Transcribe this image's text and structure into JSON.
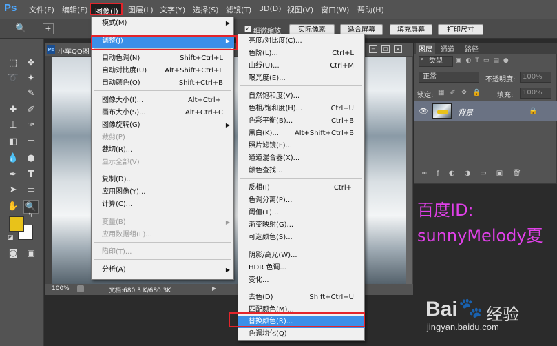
{
  "app": {
    "logo": "Ps"
  },
  "menubar": [
    {
      "label": "文件(F)"
    },
    {
      "label": "编辑(E)"
    },
    {
      "label": "图像(I)"
    },
    {
      "label": "图层(L)"
    },
    {
      "label": "文字(Y)"
    },
    {
      "label": "选择(S)"
    },
    {
      "label": "滤镜(T)"
    },
    {
      "label": "3D(D)"
    },
    {
      "label": "视图(V)"
    },
    {
      "label": "窗口(W)"
    },
    {
      "label": "帮助(H)"
    }
  ],
  "options": {
    "fine_zoom_label": "细微缩放",
    "buttons": [
      "实际像素",
      "适合屏幕",
      "填充屏幕",
      "打印尺寸"
    ]
  },
  "document": {
    "tab_title": "小车QQ图",
    "zoom": "100%",
    "status": "文档:680.3 K/680.3K"
  },
  "layers_panel": {
    "tabs": [
      "图层",
      "通道",
      "路径"
    ],
    "kind": "类型",
    "blend_mode": "正常",
    "opacity_label": "不透明度:",
    "opacity_value": "100%",
    "lock_label": "锁定:",
    "fill_label": "填充:",
    "fill_value": "100%",
    "layer_name": "背景"
  },
  "image_menu": [
    {
      "label": "模式(M)",
      "shortcut": "",
      "submenu": true,
      "disabled": false
    },
    {
      "label": "调整(J)",
      "shortcut": "",
      "submenu": true,
      "disabled": false,
      "highlighted": true
    },
    {
      "label": "自动色调(N)",
      "shortcut": "Shift+Ctrl+L",
      "submenu": false,
      "disabled": false
    },
    {
      "label": "自动对比度(U)",
      "shortcut": "Alt+Shift+Ctrl+L",
      "submenu": false,
      "disabled": false
    },
    {
      "label": "自动颜色(O)",
      "shortcut": "Shift+Ctrl+B",
      "submenu": false,
      "disabled": false
    },
    {
      "label": "图像大小(I)...",
      "shortcut": "Alt+Ctrl+I",
      "submenu": false,
      "disabled": false
    },
    {
      "label": "画布大小(S)...",
      "shortcut": "Alt+Ctrl+C",
      "submenu": false,
      "disabled": false
    },
    {
      "label": "图像旋转(G)",
      "shortcut": "",
      "submenu": true,
      "disabled": false
    },
    {
      "label": "裁剪(P)",
      "shortcut": "",
      "submenu": false,
      "disabled": true
    },
    {
      "label": "裁切(R)...",
      "shortcut": "",
      "submenu": false,
      "disabled": false
    },
    {
      "label": "显示全部(V)",
      "shortcut": "",
      "submenu": false,
      "disabled": true
    },
    {
      "label": "复制(D)...",
      "shortcut": "",
      "submenu": false,
      "disabled": false
    },
    {
      "label": "应用图像(Y)...",
      "shortcut": "",
      "submenu": false,
      "disabled": false
    },
    {
      "label": "计算(C)...",
      "shortcut": "",
      "submenu": false,
      "disabled": false
    },
    {
      "label": "变量(B)",
      "shortcut": "",
      "submenu": true,
      "disabled": true
    },
    {
      "label": "应用数据组(L)...",
      "shortcut": "",
      "submenu": false,
      "disabled": true
    },
    {
      "label": "陷印(T)...",
      "shortcut": "",
      "submenu": false,
      "disabled": true
    },
    {
      "label": "分析(A)",
      "shortcut": "",
      "submenu": true,
      "disabled": false
    }
  ],
  "adjust_menu": [
    {
      "label": "亮度/对比度(C)...",
      "shortcut": ""
    },
    {
      "label": "色阶(L)...",
      "shortcut": "Ctrl+L"
    },
    {
      "label": "曲线(U)...",
      "shortcut": "Ctrl+M"
    },
    {
      "label": "曝光度(E)...",
      "shortcut": ""
    },
    {
      "label": "自然饱和度(V)...",
      "shortcut": ""
    },
    {
      "label": "色相/饱和度(H)...",
      "shortcut": "Ctrl+U"
    },
    {
      "label": "色彩平衡(B)...",
      "shortcut": "Ctrl+B"
    },
    {
      "label": "黑白(K)...",
      "shortcut": "Alt+Shift+Ctrl+B"
    },
    {
      "label": "照片滤镜(F)...",
      "shortcut": ""
    },
    {
      "label": "通道混合器(X)...",
      "shortcut": ""
    },
    {
      "label": "颜色查找...",
      "shortcut": ""
    },
    {
      "label": "反相(I)",
      "shortcut": "Ctrl+I"
    },
    {
      "label": "色调分离(P)...",
      "shortcut": ""
    },
    {
      "label": "阈值(T)...",
      "shortcut": ""
    },
    {
      "label": "渐变映射(G)...",
      "shortcut": ""
    },
    {
      "label": "可选颜色(S)...",
      "shortcut": ""
    },
    {
      "label": "阴影/高光(W)...",
      "shortcut": ""
    },
    {
      "label": "HDR 色调...",
      "shortcut": ""
    },
    {
      "label": "变化...",
      "shortcut": ""
    },
    {
      "label": "去色(D)",
      "shortcut": "Shift+Ctrl+U"
    },
    {
      "label": "匹配颜色(M)...",
      "shortcut": ""
    },
    {
      "label": "替换颜色(R)...",
      "shortcut": "",
      "highlighted": true
    },
    {
      "label": "色调均化(Q)",
      "shortcut": ""
    }
  ],
  "watermark": {
    "line1": "百度ID:",
    "line2": "sunnyMelody夏",
    "baidu_text": "Bai",
    "baidu_jingyan": "经验",
    "url": "jingyan.baidu.com"
  },
  "colors": {
    "foreground": "#e8c21a",
    "background": "#ffffff",
    "highlight": "#3b8fe8",
    "annotation": "#e3242b",
    "watermark": "#e040e8"
  }
}
